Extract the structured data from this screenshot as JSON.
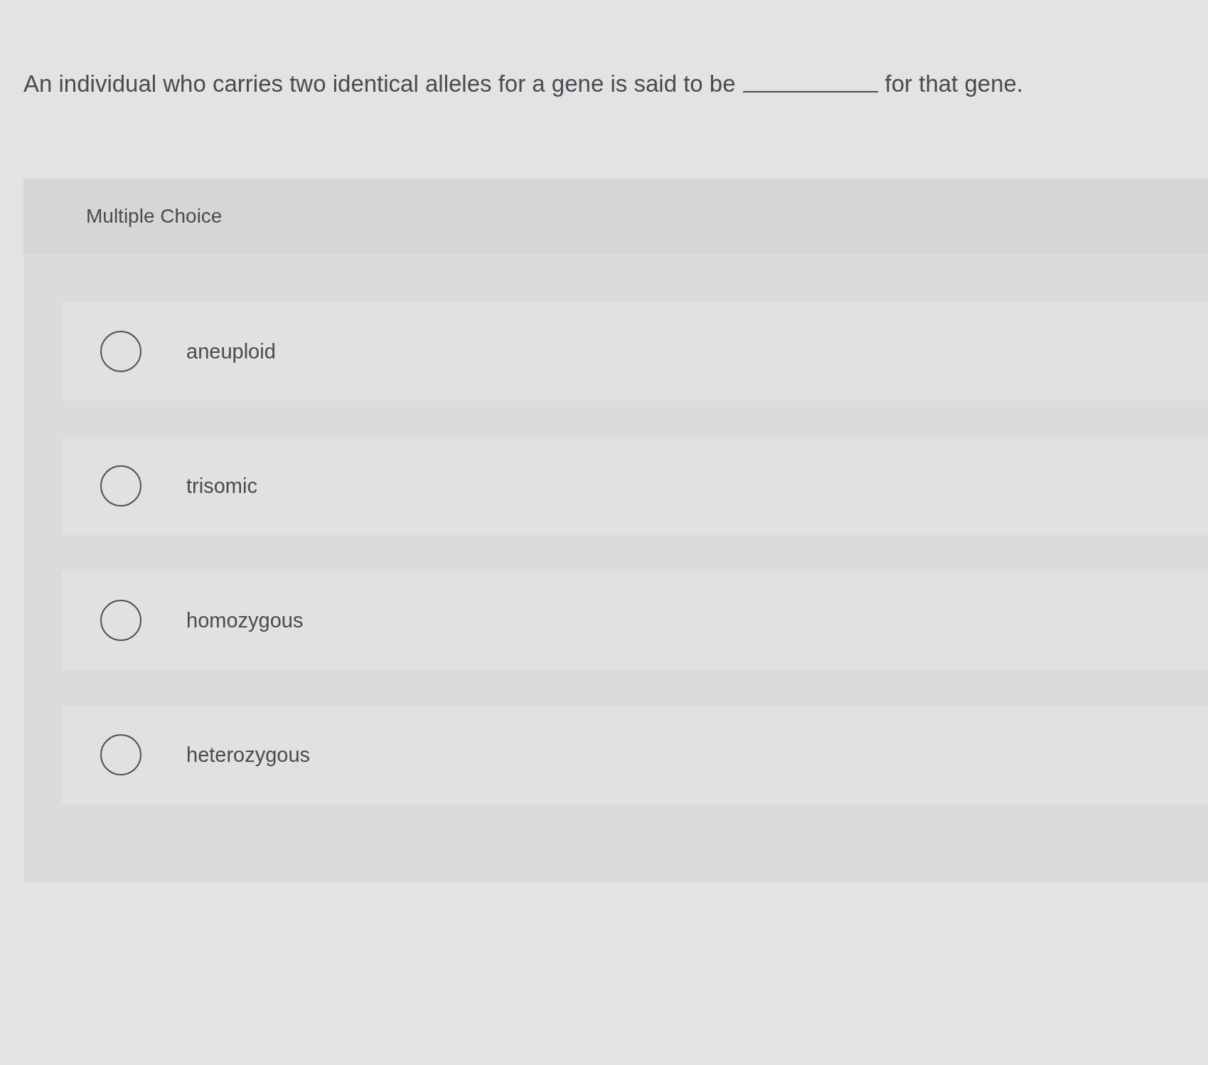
{
  "question": {
    "before_blank": "An individual who carries two identical alleles for a gene is said to be",
    "after_blank": "for that gene."
  },
  "panel": {
    "heading": "Multiple Choice"
  },
  "options": [
    {
      "label": "aneuploid",
      "selected": false
    },
    {
      "label": "trisomic",
      "selected": false
    },
    {
      "label": "homozygous",
      "selected": false
    },
    {
      "label": "heterozygous",
      "selected": false
    }
  ]
}
